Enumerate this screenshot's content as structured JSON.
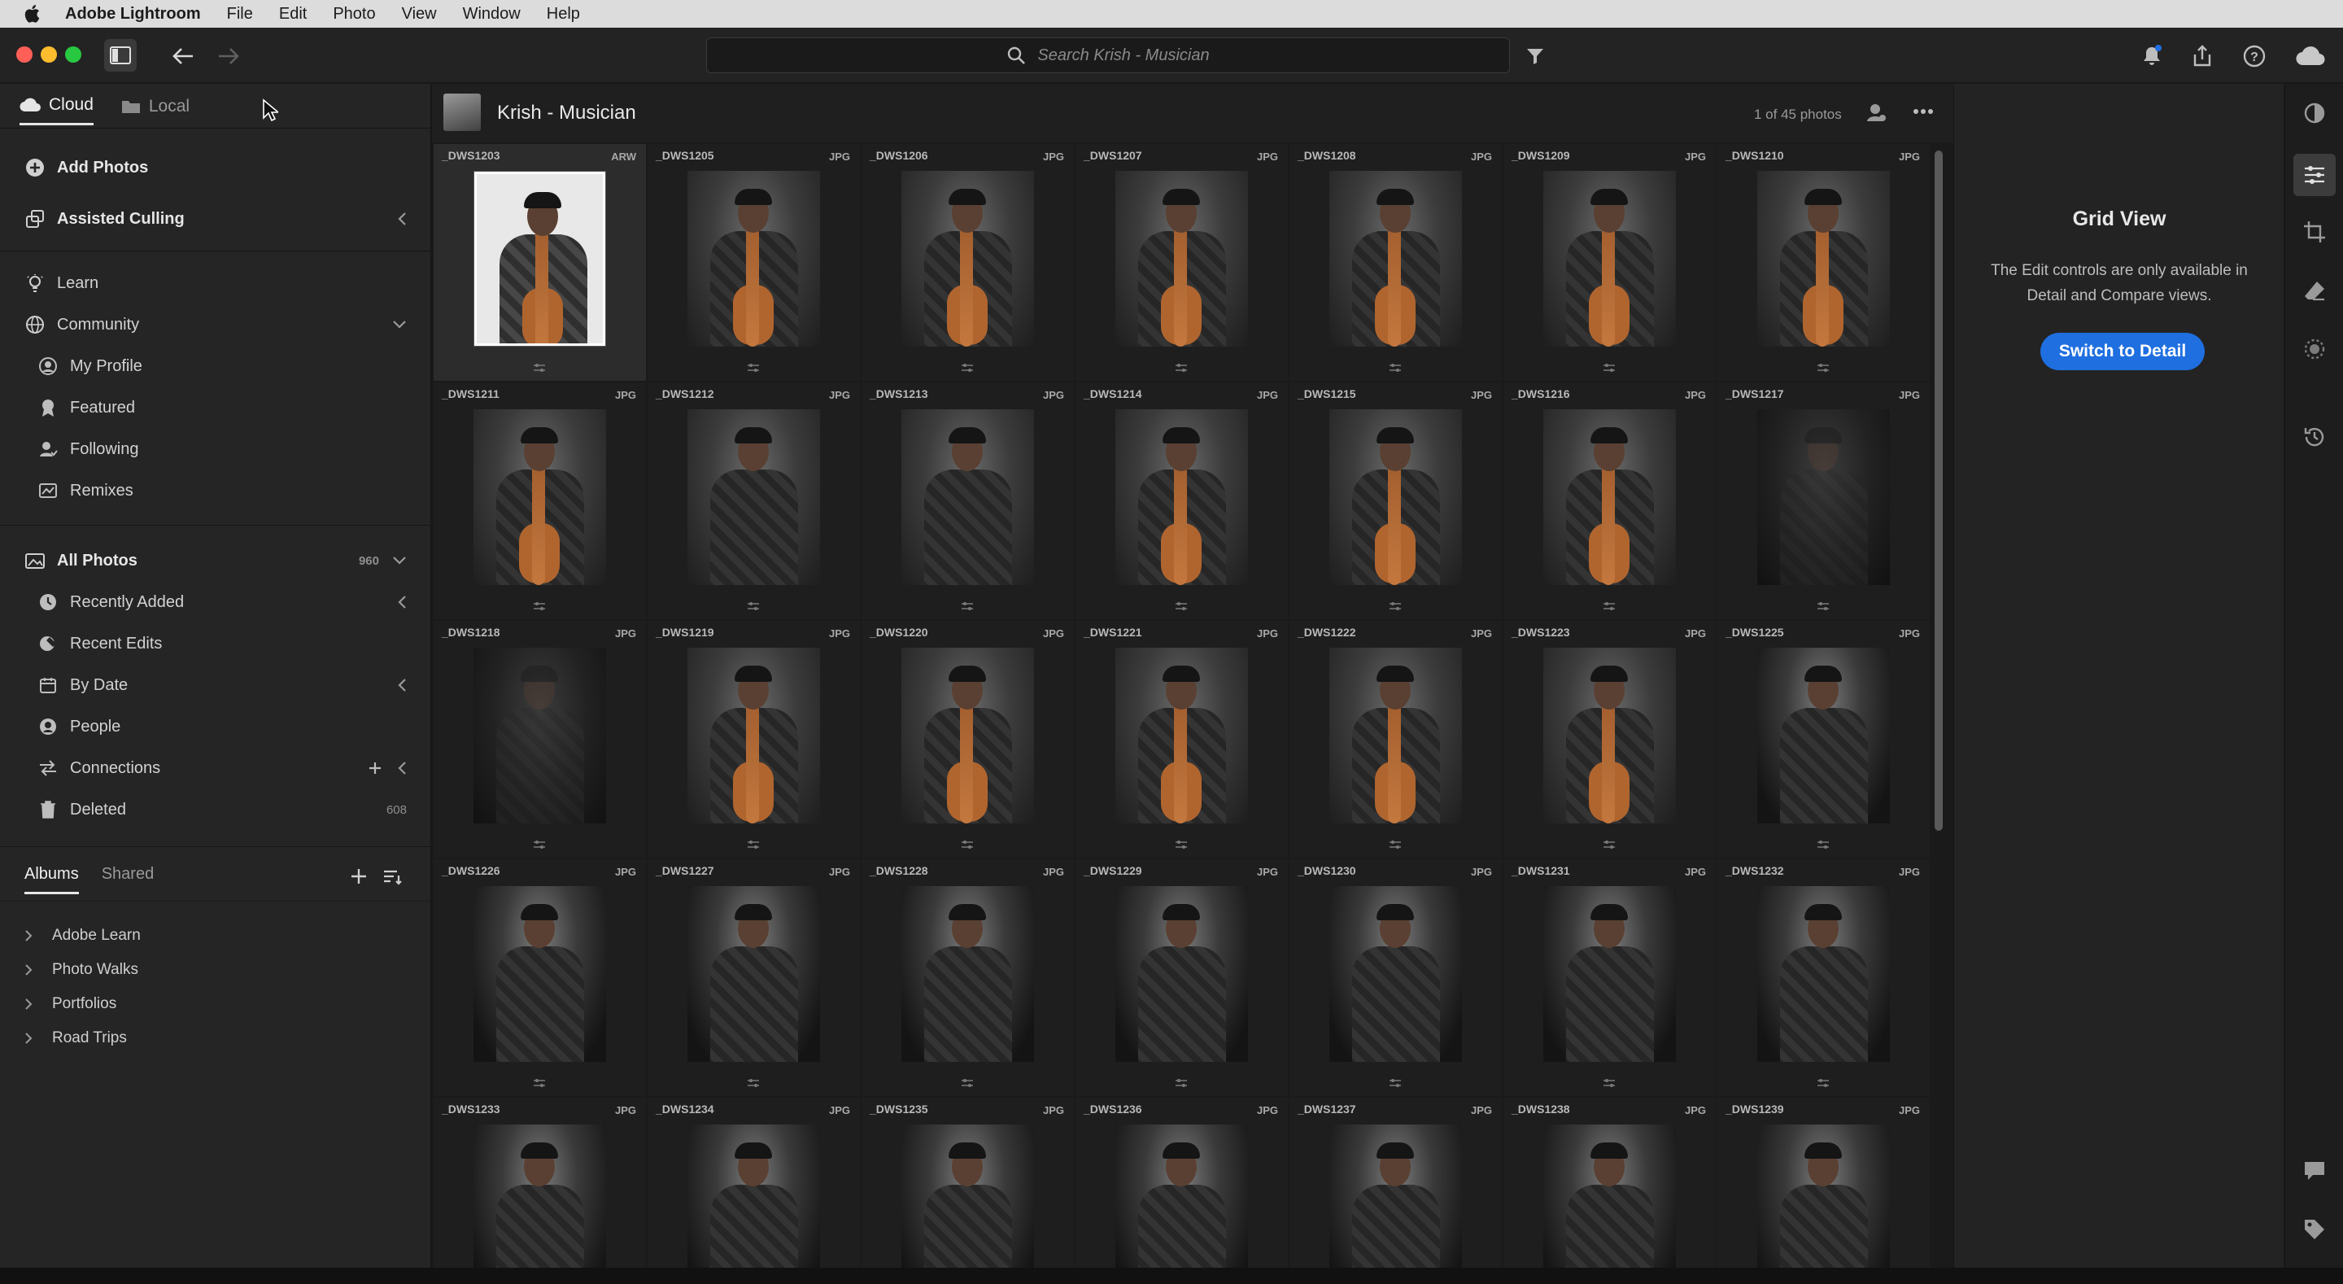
{
  "menubar": {
    "app_name": "Adobe Lightroom",
    "items": [
      "File",
      "Edit",
      "Photo",
      "View",
      "Window",
      "Help"
    ]
  },
  "toolbar": {
    "search_placeholder": "Search Krish - Musician"
  },
  "left_panel": {
    "tabs": [
      "Cloud",
      "Local"
    ],
    "add_photos": "Add Photos",
    "assisted_culling": "Assisted Culling",
    "learn": "Learn",
    "community": "Community",
    "community_items": [
      "My Profile",
      "Featured",
      "Following",
      "Remixes"
    ],
    "all_photos": "All Photos",
    "all_photos_count": "960",
    "library_items": [
      "Recently Added",
      "Recent Edits",
      "By Date",
      "People",
      "Connections",
      "Deleted"
    ],
    "deleted_count": "608",
    "album_tabs": [
      "Albums",
      "Shared"
    ],
    "albums": [
      "Adobe Learn",
      "Photo Walks",
      "Portfolios",
      "Road Trips"
    ]
  },
  "grid_header": {
    "title": "Krish - Musician",
    "photo_count": "1 of 45 photos"
  },
  "photos": [
    {
      "name": "_DWS1203",
      "ext": "ARW"
    },
    {
      "name": "_DWS1205",
      "ext": "JPG"
    },
    {
      "name": "_DWS1206",
      "ext": "JPG"
    },
    {
      "name": "_DWS1207",
      "ext": "JPG"
    },
    {
      "name": "_DWS1208",
      "ext": "JPG"
    },
    {
      "name": "_DWS1209",
      "ext": "JPG"
    },
    {
      "name": "_DWS1210",
      "ext": "JPG"
    },
    {
      "name": "_DWS1211",
      "ext": "JPG"
    },
    {
      "name": "_DWS1212",
      "ext": "JPG"
    },
    {
      "name": "_DWS1213",
      "ext": "JPG"
    },
    {
      "name": "_DWS1214",
      "ext": "JPG"
    },
    {
      "name": "_DWS1215",
      "ext": "JPG"
    },
    {
      "name": "_DWS1216",
      "ext": "JPG"
    },
    {
      "name": "_DWS1217",
      "ext": "JPG"
    },
    {
      "name": "_DWS1218",
      "ext": "JPG"
    },
    {
      "name": "_DWS1219",
      "ext": "JPG"
    },
    {
      "name": "_DWS1220",
      "ext": "JPG"
    },
    {
      "name": "_DWS1221",
      "ext": "JPG"
    },
    {
      "name": "_DWS1222",
      "ext": "JPG"
    },
    {
      "name": "_DWS1223",
      "ext": "JPG"
    },
    {
      "name": "_DWS1225",
      "ext": "JPG"
    },
    {
      "name": "_DWS1226",
      "ext": "JPG"
    },
    {
      "name": "_DWS1227",
      "ext": "JPG"
    },
    {
      "name": "_DWS1228",
      "ext": "JPG"
    },
    {
      "name": "_DWS1229",
      "ext": "JPG"
    },
    {
      "name": "_DWS1230",
      "ext": "JPG"
    },
    {
      "name": "_DWS1231",
      "ext": "JPG"
    },
    {
      "name": "_DWS1232",
      "ext": "JPG"
    },
    {
      "name": "_DWS1233",
      "ext": "JPG"
    },
    {
      "name": "_DWS1234",
      "ext": "JPG"
    },
    {
      "name": "_DWS1235",
      "ext": "JPG"
    },
    {
      "name": "_DWS1236",
      "ext": "JPG"
    },
    {
      "name": "_DWS1237",
      "ext": "JPG"
    },
    {
      "name": "_DWS1238",
      "ext": "JPG"
    },
    {
      "name": "_DWS1239",
      "ext": "JPG"
    }
  ],
  "right_panel": {
    "heading": "Grid View",
    "message": "The Edit controls are only available in Detail and Compare views.",
    "button": "Switch to Detail"
  },
  "colors": {
    "accent": "#1f6fe0",
    "traffic_red": "#ff5f57",
    "traffic_yellow": "#febc2e",
    "traffic_green": "#28c840"
  }
}
